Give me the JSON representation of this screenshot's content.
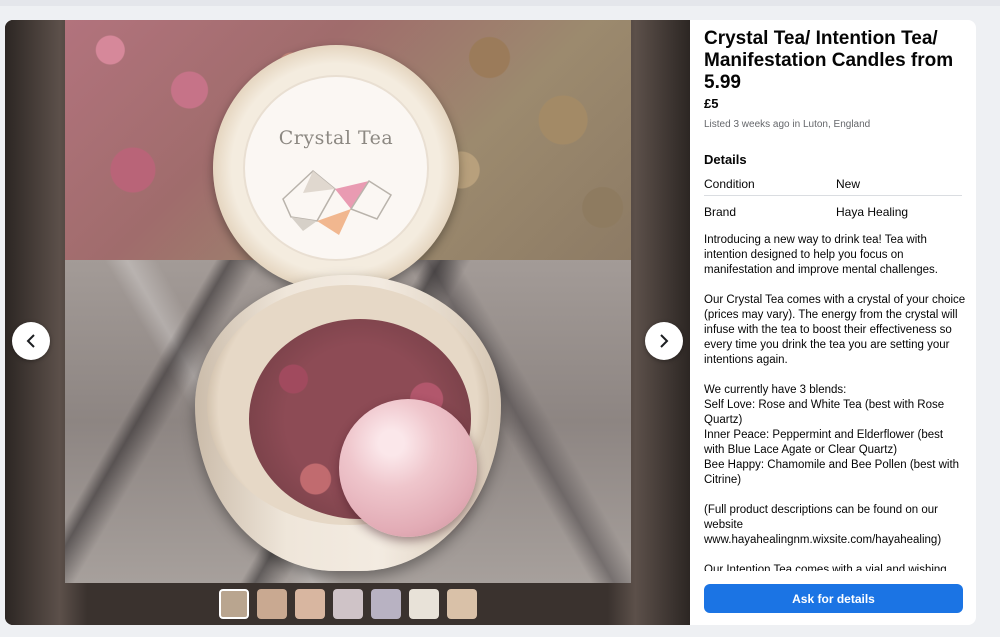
{
  "listing": {
    "title": "Crystal Tea/ Intention Tea/ Manifestation Candles from 5.99",
    "price": "£5",
    "listed": "Listed 3 weeks ago in Luton, England"
  },
  "photo": {
    "lid_label": "Crystal Tea"
  },
  "details": {
    "heading": "Details",
    "rows": [
      {
        "key": "Condition",
        "value": "New"
      },
      {
        "key": "Brand",
        "value": "Haya Healing"
      }
    ]
  },
  "description": "Introducing a new way to drink tea! Tea with intention designed to help you focus on manifestation and improve mental challenges.\n\nOur Crystal Tea comes with a crystal of your choice (prices may vary). The energy from the crystal will infuse with the tea to boost their effectiveness so every time you drink the tea you are setting your intentions again.\n\nWe currently have 3 blends:\nSelf Love: Rose and White Tea (best with Rose Quartz)\nInner Peace: Peppermint and Elderflower (best with Blue Lace Agate or Clear Quartz)\nBee Happy: Chamomile and Bee Pollen (best with Citrine)\n\n(Full product descriptions can be found on our website\nwww.hayahealingnm.wixsite.com/hayahealing)\n\nOur Intention Tea comes with a vial and wishing",
  "actions": {
    "ask_label": "Ask for details"
  },
  "viewer": {
    "prev_icon": "chevron-left-icon",
    "next_icon": "chevron-right-icon",
    "thumbnail_colors": [
      "#b9a58f",
      "#c9a991",
      "#d8b6a0",
      "#cfc3c7",
      "#b8b2c2",
      "#e8e2d8",
      "#d9c1a8"
    ]
  },
  "colors": {
    "accent": "#1b74e4"
  }
}
